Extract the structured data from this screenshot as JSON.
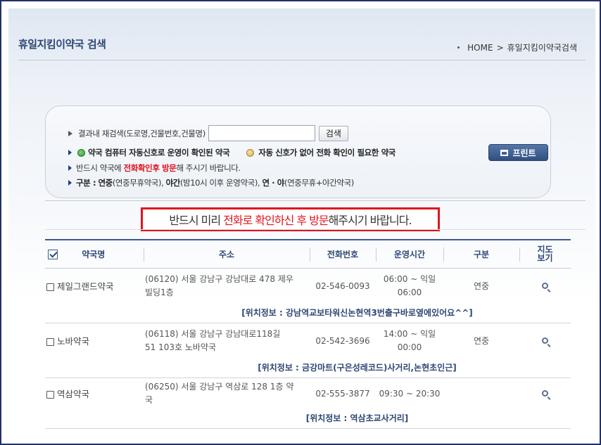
{
  "page": {
    "title": "휴일지킴이약국 검색",
    "breadcrumb": {
      "home": "HOME",
      "separator": ">",
      "current": "휴일지킴이약국검색"
    }
  },
  "search": {
    "label": "결과내 재검색(도로명,건물번호,건물명)",
    "input_value": "",
    "button_label": "검색",
    "print_label": "프린트",
    "legend_green": "약국 컴퓨터 자동신호로 운영이 확인된 약국",
    "legend_yellow": "자동 신호가 없어 전화 확인이 필요한 약국",
    "must_prefix": "반드시 약국에",
    "must_emph": "전화확인후 방문",
    "must_suffix": "해 주시기 바랍니다.",
    "type_label": "구분 :",
    "type_yeonjung": "연중",
    "type_yeonjung_desc": "(연중무휴약국),",
    "type_yagan": "야간",
    "type_yagan_desc": "(밤10시 이후 운영약국),",
    "type_both": "연 · 야",
    "type_both_desc": "(연중무휴+야간약국)"
  },
  "notice": {
    "prefix": "반드시 미리",
    "emph": "전화로 확인하신 후 방문",
    "suffix": "해주시기 바랍니다."
  },
  "table": {
    "headers": {
      "name": "약국명",
      "address": "주소",
      "phone": "전화번호",
      "hours": "운영시간",
      "type": "구분",
      "map_line1": "지도",
      "map_line2": "보기"
    },
    "rows": [
      {
        "name": "제일그랜드약국",
        "address_line1": "(06120) 서울 강남구 강남대로 478 제우",
        "address_line2": "빌딩1층",
        "phone": "02-546-0093",
        "hours_line1": "06:00 ~ 익일",
        "hours_line2": "06:00",
        "type": "연중",
        "location": "[위치정보 : 강남역교보타워신논현역3번출구바로옆에있어요^^]"
      },
      {
        "name": "노바약국",
        "address_line1": "(06118) 서울 강남구 강남대로118길",
        "address_line2": "51 103호 노바약국",
        "phone": "02-542-3696",
        "hours_line1": "14:00 ~ 익일",
        "hours_line2": "00:00",
        "type": "연중",
        "location": "[위치정보 : 금강마트(구은성레코드)사거리,논현초인근]"
      },
      {
        "name": "역삼약국",
        "address_line1": "(06250) 서울 강남구 역삼로 128 1층 약",
        "address_line2": "국",
        "phone": "02-555-3877",
        "hours_line1": "09:30 ~ 20:30",
        "hours_line2": "",
        "type": "",
        "location": "[위치정보 : 역삼초교사거리]"
      }
    ]
  },
  "colors": {
    "frame": "#20306a",
    "title": "#2d4774",
    "emphasis_red": "#e0141e",
    "print_button": "#3a5a8c"
  }
}
